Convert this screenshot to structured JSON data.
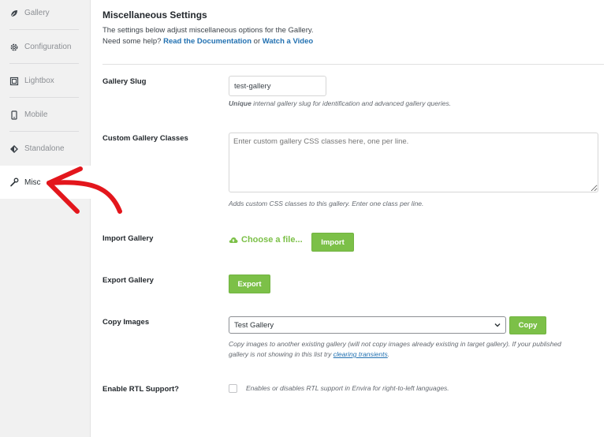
{
  "sidebar": {
    "items": [
      {
        "label": "Gallery",
        "icon": "leaf-icon"
      },
      {
        "label": "Configuration",
        "icon": "gear-icon"
      },
      {
        "label": "Lightbox",
        "icon": "lightbox-icon"
      },
      {
        "label": "Mobile",
        "icon": "mobile-icon"
      },
      {
        "label": "Standalone",
        "icon": "diamond-icon"
      },
      {
        "label": "Misc",
        "icon": "wrench-icon"
      }
    ],
    "active": "Misc"
  },
  "header": {
    "title": "Miscellaneous Settings",
    "description": "The settings below adjust miscellaneous options for the Gallery.",
    "help_prefix": "Need some help?",
    "docs_link": "Read the Documentation",
    "or_text": "or",
    "video_link": "Watch a Video"
  },
  "fields": {
    "slug": {
      "label": "Gallery Slug",
      "value": "test-gallery",
      "help_bold": "Unique",
      "help_rest": " internal gallery slug for identification and advanced gallery queries."
    },
    "classes": {
      "label": "Custom Gallery Classes",
      "placeholder": "Enter custom gallery CSS classes here, one per line.",
      "help": "Adds custom CSS classes to this gallery. Enter one class per line."
    },
    "import": {
      "label": "Import Gallery",
      "choose_label": "Choose a file...",
      "button": "Import"
    },
    "export": {
      "label": "Export Gallery",
      "button": "Export"
    },
    "copy": {
      "label": "Copy Images",
      "selected": "Test Gallery",
      "button": "Copy",
      "help_line1": "Copy images to another existing gallery (will not copy images already existing in target gallery). If your published",
      "help_line2_prefix": "gallery is not showing in this list try ",
      "help_link": "clearing transients",
      "help_line2_suffix": "."
    },
    "rtl": {
      "label": "Enable RTL Support?",
      "help": "Enables or disables RTL support in Envira for right-to-left languages.",
      "checked": false
    }
  },
  "colors": {
    "accent_green": "#7cc048",
    "link_blue": "#2271b1",
    "annotation_red": "#e3161c"
  }
}
